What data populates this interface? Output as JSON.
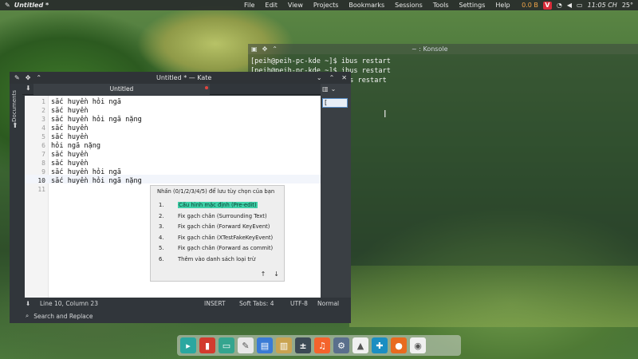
{
  "topbar": {
    "window_title": "Untitled *",
    "menu": [
      "File",
      "Edit",
      "View",
      "Projects",
      "Bookmarks",
      "Sessions",
      "Tools",
      "Settings",
      "Help"
    ],
    "net": "0.0 B",
    "vivaldi": "V",
    "time": "11:05 CH",
    "temp": "25°"
  },
  "terminal": {
    "title": "~ : Konsole",
    "lines": [
      "[peih@peih-pc-kde ~]$ ibus restart",
      "[peih@peih-pc-kde ~]$ ibus restart",
      "                     ibus restart"
    ]
  },
  "kate": {
    "title": "Untitled * — Kate",
    "tab_label": "Untitled",
    "side_label": "Documents",
    "line_numbers": [
      "1",
      "2",
      "3",
      "4",
      "5",
      "6",
      "7",
      "8",
      "9",
      "10",
      "11"
    ],
    "lines": [
      "sắc huyền hỏi ngã",
      "sắc huyền",
      "sắc huyền hỏi ngã nặng",
      "sắc huyền",
      "sắc huyền",
      "hỏi ngã nặng",
      "sắc huyền",
      "sắc huyền",
      "sắc huyền hỏi ngã",
      "sắc huyền hỏi ngã nặng",
      ""
    ],
    "minimap_char": "[",
    "status": {
      "position": "Line 10, Column 23",
      "mode": "INSERT",
      "tabs": "Soft Tabs: 4",
      "encoding": "UTF-8",
      "syntax": "Normal"
    },
    "search_replace": "Search and Replace"
  },
  "ibus_popup": {
    "header": "Nhấn (0/1/2/3/4/5) để lưu tùy chọn của bạn",
    "options": [
      {
        "num": "1.",
        "label": "Cấu hình mặc định (Pre-edit)",
        "selected": true
      },
      {
        "num": "2.",
        "label": "Fix gạch chân (Surrounding Text)",
        "selected": false
      },
      {
        "num": "3.",
        "label": "Fix gạch chân (Forward KeyEvent)",
        "selected": false
      },
      {
        "num": "4.",
        "label": "Fix gạch chân (XTestFakeKeyEvent)",
        "selected": false
      },
      {
        "num": "5.",
        "label": "Fix gạch chân (Forward as commit)",
        "selected": false
      },
      {
        "num": "6.",
        "label": "Thêm vào danh sách loại trừ",
        "selected": false
      }
    ],
    "up_arrow": "↑",
    "down_arrow": "↓"
  },
  "dock": {
    "apps": [
      {
        "name": "terminal-app-icon",
        "color": "#2aa7a0",
        "glyph": "▸"
      },
      {
        "name": "music-visualizer-app-icon",
        "color": "#d23b2e",
        "glyph": "▮"
      },
      {
        "name": "files-app-icon",
        "color": "#34a58f",
        "glyph": "▭"
      },
      {
        "name": "text-editor-app-icon",
        "color": "#e8e8e8",
        "glyph": "✎"
      },
      {
        "name": "document-viewer-app-icon",
        "color": "#3a7bd5",
        "glyph": "▤"
      },
      {
        "name": "archive-app-icon",
        "color": "#c9a351",
        "glyph": "▥"
      },
      {
        "name": "calculator-app-icon",
        "color": "#3c4a55",
        "glyph": "±"
      },
      {
        "name": "music-app-icon",
        "color": "#f4632c",
        "glyph": "♫"
      },
      {
        "name": "settings-app-icon",
        "color": "#5a6f8c",
        "glyph": "⚙"
      },
      {
        "name": "vlc-app-icon",
        "color": "#f0f0f0",
        "glyph": "▲"
      },
      {
        "name": "kodi-app-icon",
        "color": "#1b8ec2",
        "glyph": "✚"
      },
      {
        "name": "firefox-app-icon",
        "color": "#e86a1f",
        "glyph": "●"
      },
      {
        "name": "chrome-app-icon",
        "color": "#f0f0f0",
        "glyph": "◉"
      }
    ]
  }
}
